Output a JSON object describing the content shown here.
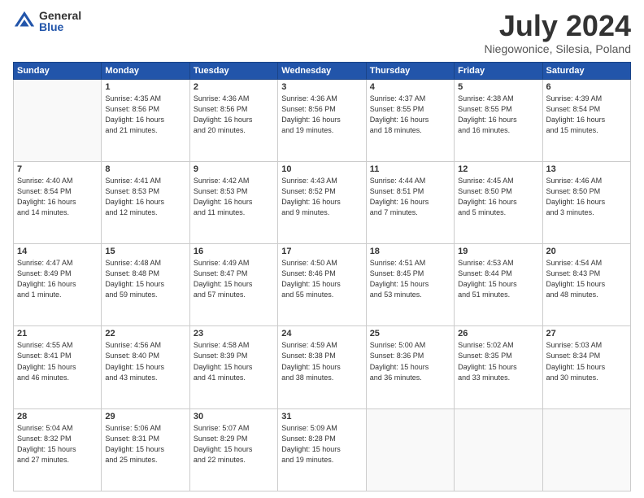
{
  "logo": {
    "general": "General",
    "blue": "Blue"
  },
  "title": "July 2024",
  "subtitle": "Niegowonice, Silesia, Poland",
  "header_days": [
    "Sunday",
    "Monday",
    "Tuesday",
    "Wednesday",
    "Thursday",
    "Friday",
    "Saturday"
  ],
  "weeks": [
    [
      {
        "day": "",
        "info": ""
      },
      {
        "day": "1",
        "info": "Sunrise: 4:35 AM\nSunset: 8:56 PM\nDaylight: 16 hours\nand 21 minutes."
      },
      {
        "day": "2",
        "info": "Sunrise: 4:36 AM\nSunset: 8:56 PM\nDaylight: 16 hours\nand 20 minutes."
      },
      {
        "day": "3",
        "info": "Sunrise: 4:36 AM\nSunset: 8:56 PM\nDaylight: 16 hours\nand 19 minutes."
      },
      {
        "day": "4",
        "info": "Sunrise: 4:37 AM\nSunset: 8:55 PM\nDaylight: 16 hours\nand 18 minutes."
      },
      {
        "day": "5",
        "info": "Sunrise: 4:38 AM\nSunset: 8:55 PM\nDaylight: 16 hours\nand 16 minutes."
      },
      {
        "day": "6",
        "info": "Sunrise: 4:39 AM\nSunset: 8:54 PM\nDaylight: 16 hours\nand 15 minutes."
      }
    ],
    [
      {
        "day": "7",
        "info": "Sunrise: 4:40 AM\nSunset: 8:54 PM\nDaylight: 16 hours\nand 14 minutes."
      },
      {
        "day": "8",
        "info": "Sunrise: 4:41 AM\nSunset: 8:53 PM\nDaylight: 16 hours\nand 12 minutes."
      },
      {
        "day": "9",
        "info": "Sunrise: 4:42 AM\nSunset: 8:53 PM\nDaylight: 16 hours\nand 11 minutes."
      },
      {
        "day": "10",
        "info": "Sunrise: 4:43 AM\nSunset: 8:52 PM\nDaylight: 16 hours\nand 9 minutes."
      },
      {
        "day": "11",
        "info": "Sunrise: 4:44 AM\nSunset: 8:51 PM\nDaylight: 16 hours\nand 7 minutes."
      },
      {
        "day": "12",
        "info": "Sunrise: 4:45 AM\nSunset: 8:50 PM\nDaylight: 16 hours\nand 5 minutes."
      },
      {
        "day": "13",
        "info": "Sunrise: 4:46 AM\nSunset: 8:50 PM\nDaylight: 16 hours\nand 3 minutes."
      }
    ],
    [
      {
        "day": "14",
        "info": "Sunrise: 4:47 AM\nSunset: 8:49 PM\nDaylight: 16 hours\nand 1 minute."
      },
      {
        "day": "15",
        "info": "Sunrise: 4:48 AM\nSunset: 8:48 PM\nDaylight: 15 hours\nand 59 minutes."
      },
      {
        "day": "16",
        "info": "Sunrise: 4:49 AM\nSunset: 8:47 PM\nDaylight: 15 hours\nand 57 minutes."
      },
      {
        "day": "17",
        "info": "Sunrise: 4:50 AM\nSunset: 8:46 PM\nDaylight: 15 hours\nand 55 minutes."
      },
      {
        "day": "18",
        "info": "Sunrise: 4:51 AM\nSunset: 8:45 PM\nDaylight: 15 hours\nand 53 minutes."
      },
      {
        "day": "19",
        "info": "Sunrise: 4:53 AM\nSunset: 8:44 PM\nDaylight: 15 hours\nand 51 minutes."
      },
      {
        "day": "20",
        "info": "Sunrise: 4:54 AM\nSunset: 8:43 PM\nDaylight: 15 hours\nand 48 minutes."
      }
    ],
    [
      {
        "day": "21",
        "info": "Sunrise: 4:55 AM\nSunset: 8:41 PM\nDaylight: 15 hours\nand 46 minutes."
      },
      {
        "day": "22",
        "info": "Sunrise: 4:56 AM\nSunset: 8:40 PM\nDaylight: 15 hours\nand 43 minutes."
      },
      {
        "day": "23",
        "info": "Sunrise: 4:58 AM\nSunset: 8:39 PM\nDaylight: 15 hours\nand 41 minutes."
      },
      {
        "day": "24",
        "info": "Sunrise: 4:59 AM\nSunset: 8:38 PM\nDaylight: 15 hours\nand 38 minutes."
      },
      {
        "day": "25",
        "info": "Sunrise: 5:00 AM\nSunset: 8:36 PM\nDaylight: 15 hours\nand 36 minutes."
      },
      {
        "day": "26",
        "info": "Sunrise: 5:02 AM\nSunset: 8:35 PM\nDaylight: 15 hours\nand 33 minutes."
      },
      {
        "day": "27",
        "info": "Sunrise: 5:03 AM\nSunset: 8:34 PM\nDaylight: 15 hours\nand 30 minutes."
      }
    ],
    [
      {
        "day": "28",
        "info": "Sunrise: 5:04 AM\nSunset: 8:32 PM\nDaylight: 15 hours\nand 27 minutes."
      },
      {
        "day": "29",
        "info": "Sunrise: 5:06 AM\nSunset: 8:31 PM\nDaylight: 15 hours\nand 25 minutes."
      },
      {
        "day": "30",
        "info": "Sunrise: 5:07 AM\nSunset: 8:29 PM\nDaylight: 15 hours\nand 22 minutes."
      },
      {
        "day": "31",
        "info": "Sunrise: 5:09 AM\nSunset: 8:28 PM\nDaylight: 15 hours\nand 19 minutes."
      },
      {
        "day": "",
        "info": ""
      },
      {
        "day": "",
        "info": ""
      },
      {
        "day": "",
        "info": ""
      }
    ]
  ]
}
